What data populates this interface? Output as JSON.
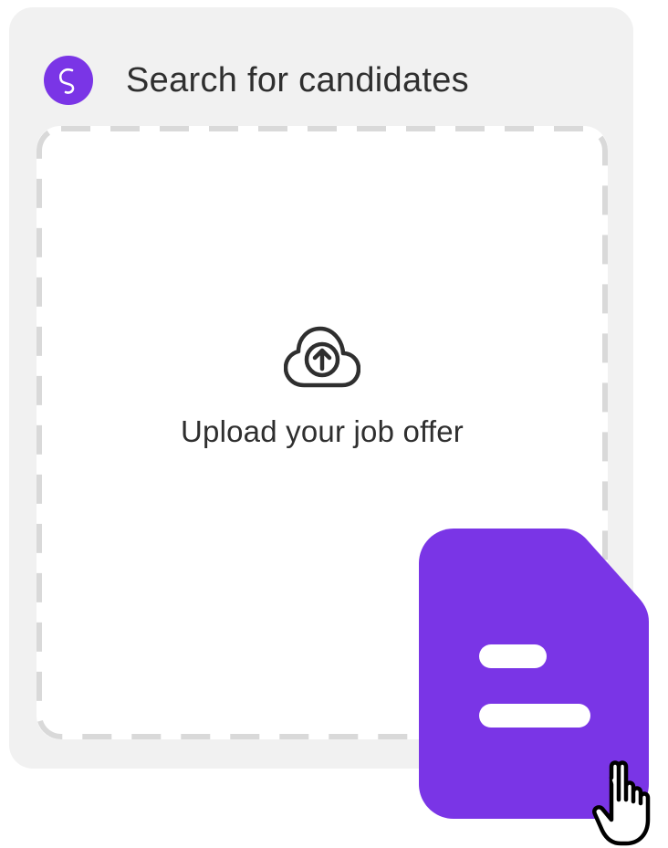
{
  "header": {
    "title": "Search for candidates",
    "logo_icon": "swirl-logo-icon"
  },
  "dropzone": {
    "label": "Upload your job offer",
    "icon": "cloud-upload-icon"
  },
  "drag_file": {
    "icon": "document-icon"
  },
  "cursor": {
    "icon": "hand-pointer-icon"
  },
  "colors": {
    "accent": "#7a35e6",
    "panel_bg": "#f1f1f1",
    "dash": "#d9d9d9",
    "text": "#2f2f2f"
  }
}
